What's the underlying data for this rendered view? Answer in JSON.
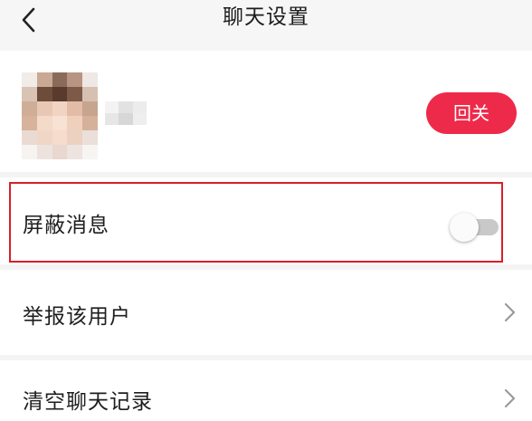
{
  "header": {
    "title": "聊天设置",
    "back_icon": "chevron-left-icon"
  },
  "profile": {
    "follow_label": "回关",
    "accent_color": "#ee2a4a"
  },
  "settings": {
    "block_messages": {
      "label": "屏蔽消息",
      "enabled": false
    },
    "report_user": {
      "label": "举报该用户",
      "icon": "chevron-right-icon"
    },
    "clear_history": {
      "label": "清空聊天记录",
      "icon": "chevron-right-icon"
    }
  }
}
